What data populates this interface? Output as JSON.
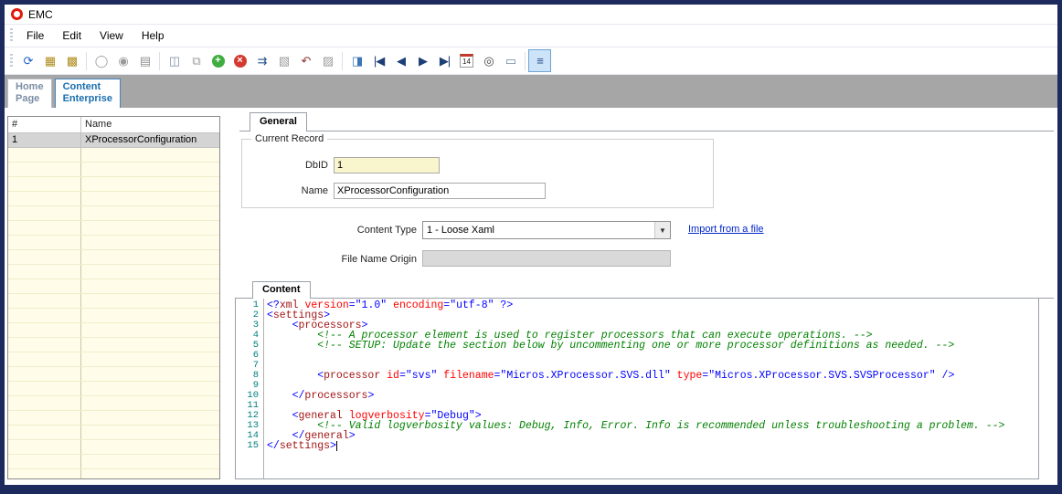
{
  "window": {
    "title": "EMC"
  },
  "menu": {
    "items": [
      "File",
      "Edit",
      "View",
      "Help"
    ]
  },
  "toolbar": {
    "items": [
      {
        "name": "refresh-button",
        "glyph": "⟳",
        "color": "#1f62c4"
      },
      {
        "name": "insert-record-button",
        "glyph": "▦",
        "color": "#b08d1d"
      },
      {
        "name": "edit-record-button",
        "glyph": "▩",
        "color": "#b08d1d"
      },
      {
        "sep": true
      },
      {
        "name": "view-record-button",
        "glyph": "◯",
        "color": "#9b9b9b"
      },
      {
        "name": "view-all-button",
        "glyph": "◉",
        "color": "#9b9b9b"
      },
      {
        "name": "print-button",
        "glyph": "▤",
        "color": "#8f8f8f"
      },
      {
        "sep": true
      },
      {
        "name": "save-button",
        "glyph": "◫",
        "color": "#7d8ea6"
      },
      {
        "name": "save-all-button",
        "glyph": "⧉",
        "color": "#9b9b9b"
      },
      {
        "name": "add-record-button",
        "glyph": "+",
        "badge": "#3fae3f"
      },
      {
        "name": "delete-record-button",
        "glyph": "×",
        "badge": "#d43a2f"
      },
      {
        "name": "distribute-button",
        "glyph": "⇉",
        "color": "#27508f"
      },
      {
        "name": "copy-button",
        "glyph": "▧",
        "color": "#9b9b9b"
      },
      {
        "name": "undo-button",
        "glyph": "↶",
        "color": "#8d3535"
      },
      {
        "name": "paste-button",
        "glyph": "▨",
        "color": "#9b9b9b"
      },
      {
        "sep": true
      },
      {
        "name": "copy-record-button",
        "glyph": "◨",
        "color": "#3a76b5"
      },
      {
        "name": "first-record-button",
        "glyph": "|◀",
        "color": "#1d3f77"
      },
      {
        "name": "previous-record-button",
        "glyph": "◀",
        "color": "#1d3f77"
      },
      {
        "name": "next-record-button",
        "glyph": "▶",
        "color": "#1d3f77"
      },
      {
        "name": "last-record-button",
        "glyph": "▶|",
        "color": "#1d3f77"
      },
      {
        "name": "calendar-button",
        "glyph": "14",
        "cal": true
      },
      {
        "name": "find-button",
        "glyph": "◎",
        "color": "#444444"
      },
      {
        "name": "form-view-button",
        "glyph": "▭",
        "color": "#6f87a6"
      },
      {
        "sep": true
      },
      {
        "name": "table-view-button",
        "glyph": "≡",
        "color": "#27508f",
        "active": true
      }
    ]
  },
  "nav_tabs": [
    {
      "line1": "Home",
      "line2": "Page",
      "active": false
    },
    {
      "line1": "Content",
      "line2": "Enterprise",
      "active": true
    }
  ],
  "record_list": {
    "columns": [
      "#",
      "Name"
    ],
    "rows": [
      [
        "1",
        "XProcessorConfiguration"
      ]
    ],
    "empty_rows": 23
  },
  "detail": {
    "general_tab": "General",
    "group_title": "Current Record",
    "fields": {
      "dbid": {
        "label": "DbID",
        "value": "1"
      },
      "name": {
        "label": "Name",
        "value": "XProcessorConfiguration"
      },
      "content_type": {
        "label": "Content Type",
        "value": "1 - Loose Xaml"
      },
      "file_name_origin": {
        "label": "File Name Origin",
        "value": ""
      }
    },
    "import_link": "Import from a file",
    "content_tab": "Content"
  },
  "colors": {
    "window_border": "#1c2a5e",
    "active_tab_text": "#1b6fae",
    "tab_strip": "#a6a6a6",
    "grid_empty_row": "#fffde9",
    "required_field": "#f9f5cd",
    "link": "#0026c8",
    "line_numbers": "#00807e",
    "logo_red": "#e11b0c"
  },
  "editor": {
    "token_colors": {
      "d": "#0000ff",
      "n": "#a31515",
      "a": "#ff0000",
      "v": "#0000ff",
      "c": "#008000",
      "p": "#000000"
    },
    "lines": [
      {
        "n": 1,
        "s": [
          [
            "d",
            "<?"
          ],
          [
            "n",
            "xml"
          ],
          [
            "p",
            " "
          ],
          [
            "a",
            "version"
          ],
          [
            "d",
            "="
          ],
          [
            "v",
            "\"1.0\""
          ],
          [
            "p",
            " "
          ],
          [
            "a",
            "encoding"
          ],
          [
            "d",
            "="
          ],
          [
            "v",
            "\"utf-8\""
          ],
          [
            "p",
            " "
          ],
          [
            "d",
            "?>"
          ]
        ]
      },
      {
        "n": 2,
        "s": [
          [
            "d",
            "<"
          ],
          [
            "n",
            "settings"
          ],
          [
            "d",
            ">"
          ]
        ]
      },
      {
        "n": 3,
        "s": [
          [
            "p",
            "    "
          ],
          [
            "d",
            "<"
          ],
          [
            "n",
            "processors"
          ],
          [
            "d",
            ">"
          ]
        ]
      },
      {
        "n": 4,
        "s": [
          [
            "p",
            "        "
          ],
          [
            "c",
            "<!-- A processor element is used to register processors that can execute operations. -->"
          ]
        ]
      },
      {
        "n": 5,
        "s": [
          [
            "p",
            "        "
          ],
          [
            "c",
            "<!-- SETUP: Update the section below by uncommenting one or more processor definitions as needed. -->"
          ]
        ]
      },
      {
        "n": 6,
        "s": []
      },
      {
        "n": 7,
        "s": []
      },
      {
        "n": 8,
        "s": [
          [
            "p",
            "        "
          ],
          [
            "d",
            "<"
          ],
          [
            "n",
            "processor"
          ],
          [
            "p",
            " "
          ],
          [
            "a",
            "id"
          ],
          [
            "d",
            "="
          ],
          [
            "v",
            "\"svs\""
          ],
          [
            "p",
            " "
          ],
          [
            "a",
            "filename"
          ],
          [
            "d",
            "="
          ],
          [
            "v",
            "\"Micros.XProcessor.SVS.dll\""
          ],
          [
            "p",
            " "
          ],
          [
            "a",
            "type"
          ],
          [
            "d",
            "="
          ],
          [
            "v",
            "\"Micros.XProcessor.SVS.SVSProcessor\""
          ],
          [
            "p",
            " "
          ],
          [
            "d",
            "/>"
          ]
        ]
      },
      {
        "n": 9,
        "s": []
      },
      {
        "n": 10,
        "s": [
          [
            "p",
            "    "
          ],
          [
            "d",
            "</"
          ],
          [
            "n",
            "processors"
          ],
          [
            "d",
            ">"
          ]
        ]
      },
      {
        "n": 11,
        "s": []
      },
      {
        "n": 12,
        "s": [
          [
            "p",
            "    "
          ],
          [
            "d",
            "<"
          ],
          [
            "n",
            "general"
          ],
          [
            "p",
            " "
          ],
          [
            "a",
            "logverbosity"
          ],
          [
            "d",
            "="
          ],
          [
            "v",
            "\"Debug\""
          ],
          [
            "d",
            ">"
          ]
        ]
      },
      {
        "n": 13,
        "s": [
          [
            "p",
            "        "
          ],
          [
            "c",
            "<!-- Valid logverbosity values: Debug, Info, Error. Info is recommended unless troubleshooting a problem. -->"
          ]
        ]
      },
      {
        "n": 14,
        "s": [
          [
            "p",
            "    "
          ],
          [
            "d",
            "</"
          ],
          [
            "n",
            "general"
          ],
          [
            "d",
            ">"
          ]
        ]
      },
      {
        "n": 15,
        "s": [
          [
            "d",
            "</"
          ],
          [
            "n",
            "settings"
          ],
          [
            "d",
            ">"
          ]
        ],
        "caret": true
      }
    ]
  }
}
